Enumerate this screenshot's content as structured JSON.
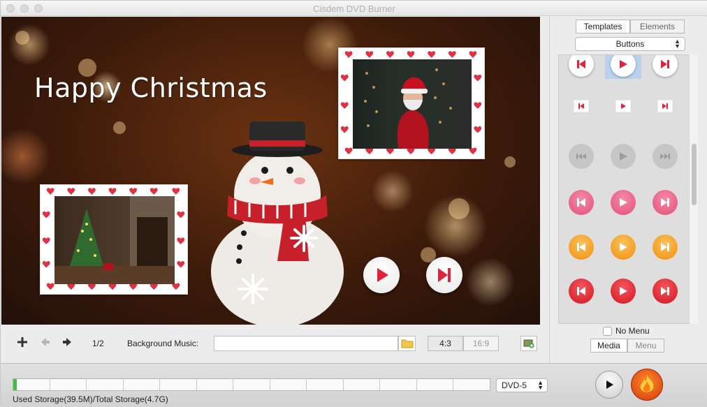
{
  "window": {
    "title": "Cisdem DVD Burner"
  },
  "preview": {
    "headline": "Happy Christmas",
    "buttons": [
      "play-icon",
      "next-chapter-icon"
    ]
  },
  "toolbar": {
    "page_indicator": "1/2",
    "background_music_label": "Background Music:",
    "background_music_value": "",
    "aspect_4_3": "4:3",
    "aspect_16_9": "16:9"
  },
  "sidebar": {
    "tabs": [
      "Templates",
      "Elements"
    ],
    "active_tab": "Templates",
    "dropdown_value": "Buttons",
    "no_menu_label": "No Menu",
    "no_menu_checked": false,
    "bottom_tabs": [
      "Media",
      "Menu"
    ],
    "active_bottom_tab": "Media",
    "button_styles": [
      {
        "style": "white-circle-red-icon",
        "accent": "#e0223a"
      },
      {
        "style": "small-square-red-icon",
        "accent": "#e0223a"
      },
      {
        "style": "grey-disabled",
        "accent": "#a8a8a8"
      },
      {
        "style": "pink",
        "accent": "#ee5f86"
      },
      {
        "style": "orange",
        "accent": "#f5a223"
      },
      {
        "style": "red",
        "accent": "#e3222c"
      }
    ]
  },
  "status": {
    "storage_text": "Used Storage(39.5M)/Total Storage(4.7G)",
    "storage_used_fraction": 0.008,
    "disc_type": "DVD-5"
  },
  "colors": {
    "progress_green": "#3bc13b",
    "selection_blue": "#b8d2ee"
  }
}
